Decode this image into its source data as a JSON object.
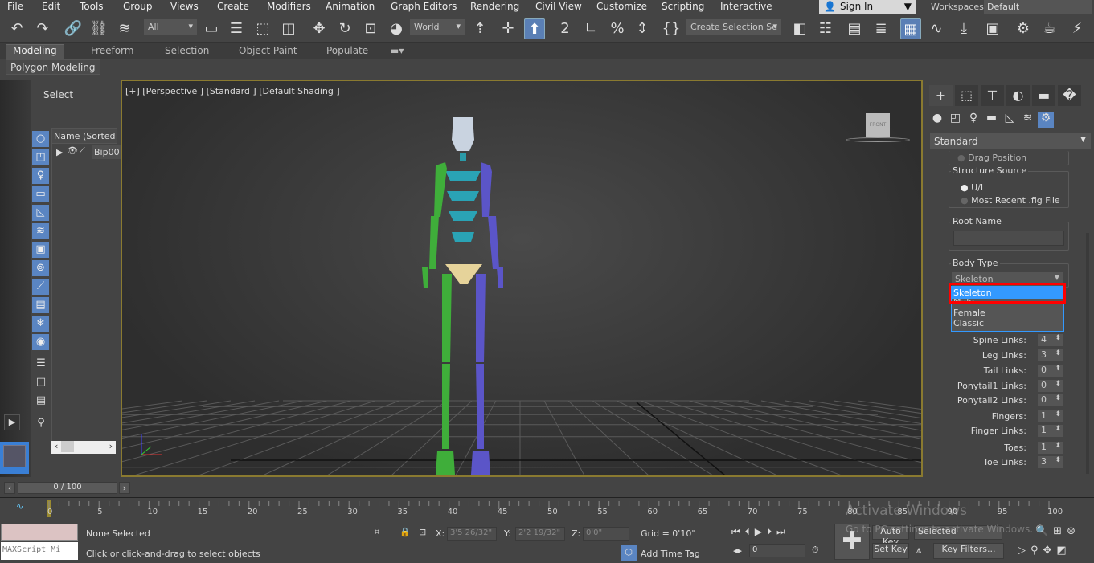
{
  "menu": [
    "File",
    "Edit",
    "Tools",
    "Group",
    "Views",
    "Create",
    "Modifiers",
    "Animation",
    "Graph Editors",
    "Rendering",
    "Civil View",
    "Customize",
    "Scripting",
    "Interactive"
  ],
  "signin": {
    "label": "Sign In"
  },
  "workspaces": {
    "label": "Workspaces:",
    "value": "Default"
  },
  "toolbar": {
    "filter": "All",
    "coord": "World",
    "selset": "Create Selection Se",
    "left_icons": [
      "undo-icon",
      "redo-icon",
      "link-icon",
      "unlink-icon",
      "bind-spacewarp-icon"
    ],
    "mid_icons": [
      "select-object-icon",
      "select-by-name-icon",
      "rect-selection-icon",
      "window-crossing-icon",
      "move-icon",
      "rotate-icon",
      "scale-icon",
      "placement-icon"
    ],
    "right_icons": [
      "pivot-center-icon",
      "keyboard-shortcut-icon",
      "select-manipulate-icon",
      "snaps-toggle-icon",
      "angle-snap-icon",
      "percent-snap-icon",
      "spinner-snap-icon",
      "edit-named-sets-icon"
    ],
    "far_icons": [
      "mirror-icon",
      "align-icon",
      "scene-explorer-icon",
      "layer-explorer-icon",
      "toggle-ribbon-icon",
      "curve-editor-icon",
      "schematic-view-icon",
      "material-editor-icon",
      "render-setup-icon",
      "rendered-frame-icon",
      "render-icon"
    ]
  },
  "ribbon": {
    "tabs": [
      "Modeling",
      "Freeform",
      "Selection",
      "Object Paint",
      "Populate"
    ],
    "active": "Modeling",
    "panel": "Polygon Modeling"
  },
  "explorer": {
    "title": "Select",
    "column": "Name (Sorted A",
    "item": "Bip00"
  },
  "viewport": {
    "label": "[+] [Perspective ] [Standard ] [Default Shading ]",
    "viewcube": "FRONT"
  },
  "cmd": {
    "dropdown": "Standard",
    "cut_label": "Drag Position",
    "structure_source": {
      "title": "Structure Source",
      "options": [
        "U/I",
        "Most Recent .fig File"
      ],
      "selected": "U/I"
    },
    "root_name": {
      "title": "Root Name",
      "value": ""
    },
    "body_type": {
      "title": "Body Type",
      "value": "Skeleton",
      "options": [
        "Skeleton",
        "Male",
        "Female",
        "Classic"
      ],
      "highlighted": "Skeleton"
    },
    "params": [
      {
        "label": "Spine Links:",
        "value": "4"
      },
      {
        "label": "Leg Links:",
        "value": "3"
      },
      {
        "label": "Tail Links:",
        "value": "0"
      },
      {
        "label": "Ponytail1 Links:",
        "value": "0"
      },
      {
        "label": "Ponytail2 Links:",
        "value": "0"
      },
      {
        "label": "Fingers:",
        "value": "1"
      },
      {
        "label": "Finger Links:",
        "value": "1"
      },
      {
        "label": "Toes:",
        "value": "1"
      },
      {
        "label": "Toe Links:",
        "value": "3"
      }
    ]
  },
  "timeline": {
    "frame": "0 / 100",
    "ticks": [
      "0",
      "5",
      "10",
      "15",
      "20",
      "25",
      "30",
      "35",
      "40",
      "45",
      "50",
      "55",
      "60",
      "65",
      "70",
      "75",
      "80",
      "85",
      "90",
      "95",
      "100"
    ]
  },
  "status": {
    "selection": "None Selected",
    "prompt": "Click or click-and-drag to select objects",
    "maxscript": "MAXScript Mi",
    "x_label": "X:",
    "x": "3'5 26/32\"",
    "y_label": "Y:",
    "y": "2'2 19/32\"",
    "z_label": "Z:",
    "z": "0'0\"",
    "grid": "Grid = 0'10\"",
    "add_time_tag": "Add Time Tag",
    "auto_key": "Auto Key",
    "key_mode": "Selected",
    "set_key": "Set Key",
    "key_filters": "Key Filters...",
    "current_frame": "0"
  },
  "watermark": {
    "title": "Activate Windows",
    "subtitle": "Go to PC settings to activate Windows."
  },
  "colors": {
    "accent": "#5a85c2",
    "highlight": "#3399ff",
    "red_box": "#ff0000",
    "viewport_border": "#8a7a30"
  }
}
